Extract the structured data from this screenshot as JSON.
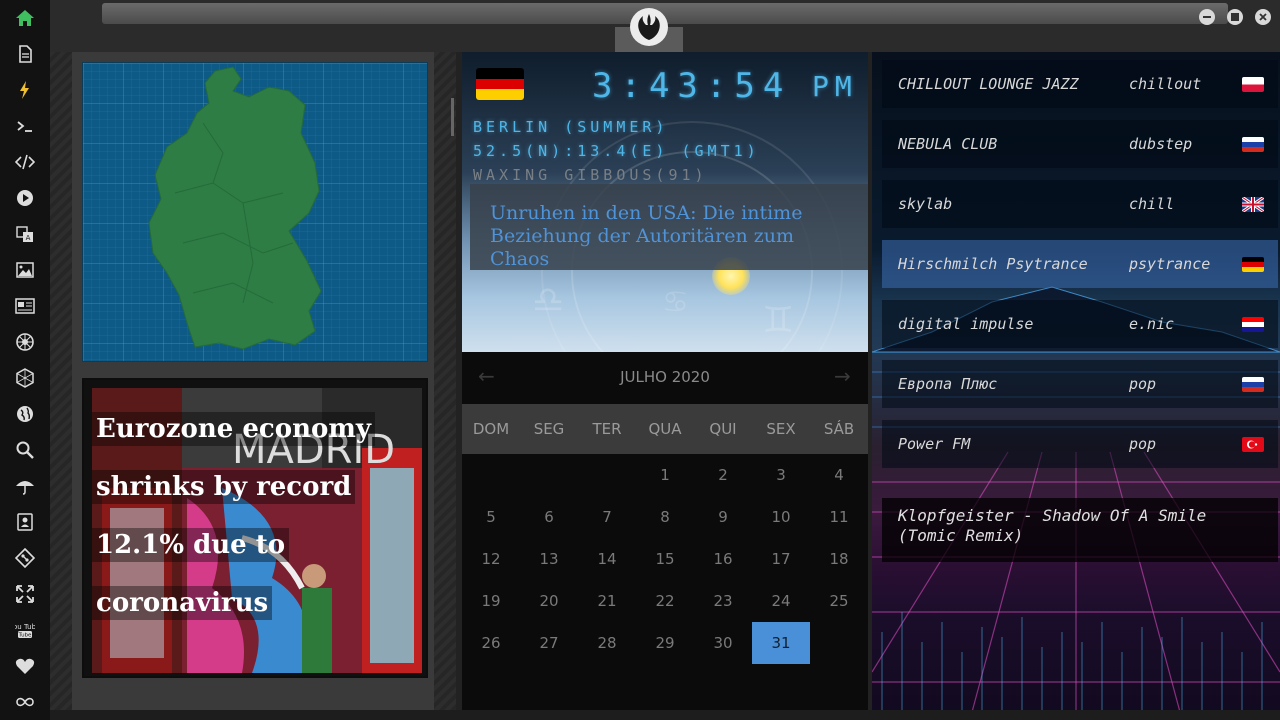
{
  "sidebar": {
    "items": [
      {
        "icon": "home-icon",
        "color": "#3fbf5f"
      },
      {
        "icon": "document-icon"
      },
      {
        "icon": "lightning-icon",
        "color": "#f0c030"
      },
      {
        "icon": "terminal-icon"
      },
      {
        "icon": "code-icon"
      },
      {
        "icon": "play-icon"
      },
      {
        "icon": "translate-icon"
      },
      {
        "icon": "image-icon"
      },
      {
        "icon": "newspaper-icon"
      },
      {
        "icon": "rebel-icon"
      },
      {
        "icon": "hexagon-icon"
      },
      {
        "icon": "globe-icon"
      },
      {
        "icon": "search-icon"
      },
      {
        "icon": "umbrella-icon"
      },
      {
        "icon": "contact-icon"
      },
      {
        "icon": "git-icon"
      },
      {
        "icon": "expand-icon"
      },
      {
        "icon": "youtube-icon",
        "label": "You Tube"
      },
      {
        "icon": "heart-icon"
      },
      {
        "icon": "infinity-icon"
      }
    ]
  },
  "titlebar": {
    "logo": "rebel-alliance-logo",
    "controls": [
      "minimize-icon",
      "maximize-icon",
      "close-icon"
    ]
  },
  "map": {
    "country": "Germany",
    "land_color": "#2e7d45",
    "water_color": "#0d5a86"
  },
  "news_photo": {
    "headline": "Eurozone economy shrinks by record 12.1% due to coronavirus",
    "lines": [
      "Eurozone economy",
      "shrinks by record",
      "12.1% due to",
      "coronavirus"
    ],
    "sign_text": "MADRID"
  },
  "clock": {
    "time": "3:43:54",
    "ampm": "PM",
    "city": "BERLIN (SUMMER)",
    "coords": "52.5(N):13.4(E) (GMT1)",
    "moon": "WAXING GIBBOUS(91)",
    "flag": "germany-flag"
  },
  "news_card": {
    "text": "Unruhen in den USA: Die intime Beziehung der Autoritären zum Chaos"
  },
  "calendar": {
    "month_label": "JULHO 2020",
    "weekdays": [
      "DOM",
      "SEG",
      "TER",
      "QUA",
      "QUI",
      "SEX",
      "SÁB"
    ],
    "first_weekday_index": 3,
    "days_in_month": 31,
    "today": 31
  },
  "radio": {
    "stations": [
      {
        "name": "CHILLOUT LOUNGE JAZZ",
        "genre": "chillout",
        "flag": "poland-flag",
        "active": false
      },
      {
        "name": "NEBULA CLUB",
        "genre": "dubstep",
        "flag": "russia-flag",
        "active": false
      },
      {
        "name": "skylab",
        "genre": "chill",
        "flag": "uk-flag",
        "active": false
      },
      {
        "name": "Hirschmilch Psytrance",
        "genre": "psytrance",
        "flag": "germany-flag",
        "active": true
      },
      {
        "name": "digital impulse",
        "genre": "e.nic",
        "flag": "croatia-flag",
        "active": false
      },
      {
        "name": "Европа Плюс",
        "genre": "pop",
        "flag": "russia-flag",
        "active": false
      },
      {
        "name": "Power FM",
        "genre": "pop",
        "flag": "turkey-flag",
        "active": false
      }
    ],
    "now_playing": "Klopfgeister - Shadow Of A Smile (Tomic Remix)"
  }
}
